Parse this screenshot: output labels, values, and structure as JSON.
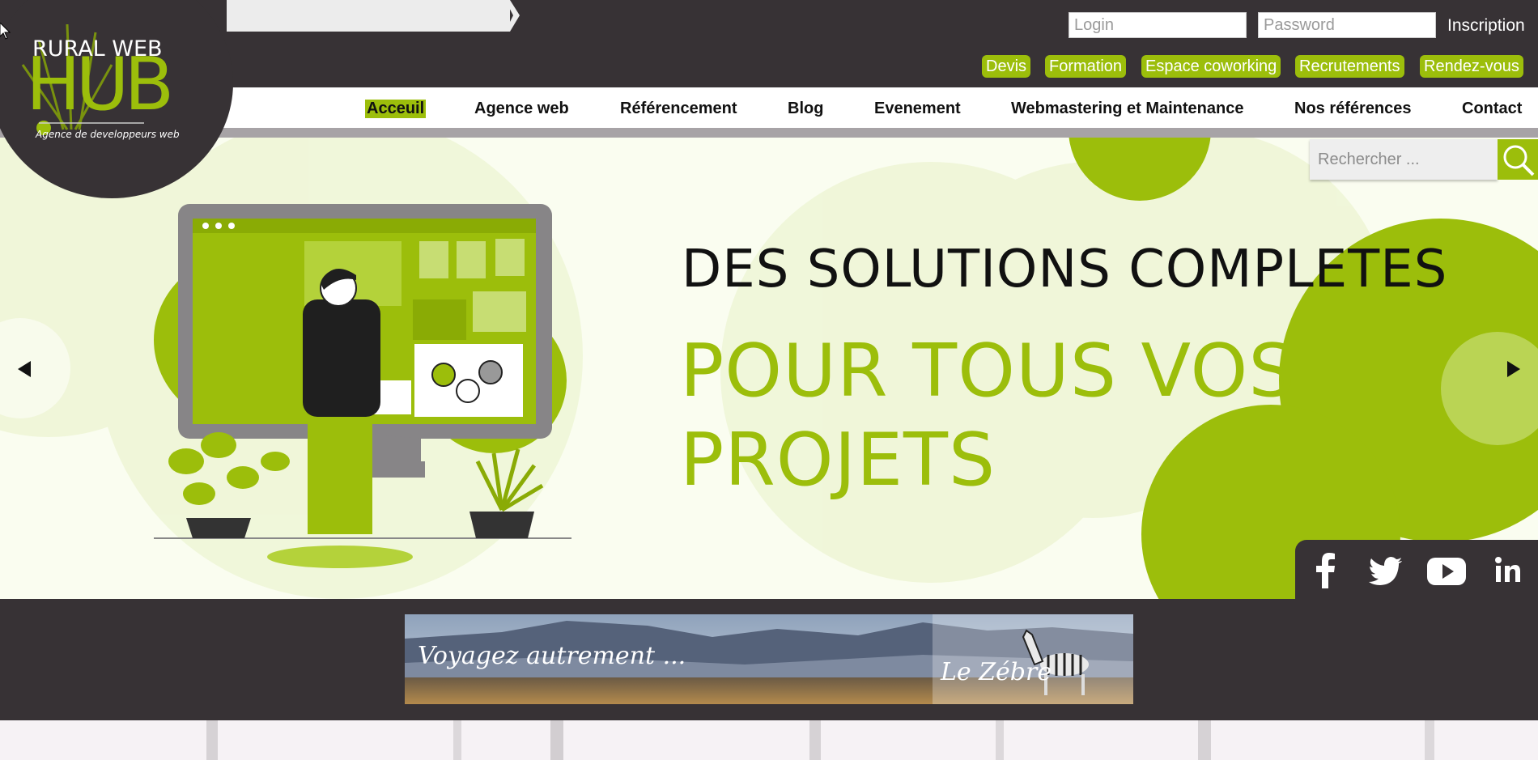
{
  "header": {
    "logo": {
      "line1": "RURAL WEB",
      "line2": "HUB",
      "tagline": "Agence de developpeurs web"
    },
    "login_placeholder": "Login",
    "password_placeholder": "Password",
    "inscription": "Inscription",
    "quick_links": [
      "Devis",
      "Formation",
      "Espace coworking",
      "Recrutements",
      "Rendez-vous"
    ]
  },
  "nav": {
    "items": [
      "Acceuil",
      "Agence web",
      "Référencement",
      "Blog",
      "Evenement",
      "Webmastering et Maintenance",
      "Nos références",
      "Contact"
    ],
    "active_index": 0
  },
  "search": {
    "placeholder": "Rechercher ..."
  },
  "hero": {
    "line1": "DES SOLUTIONS COMPLETES",
    "line2": "POUR TOUS VOS PROJETS"
  },
  "social": [
    "facebook-icon",
    "twitter-icon",
    "youtube-icon",
    "linkedin-icon"
  ],
  "banner": {
    "text1": "Voyagez autrement ...",
    "text2": "Le Zébre"
  },
  "colors": {
    "accent": "#9cbe0b",
    "dark": "#373235",
    "nav_line": "#a7a3a6"
  }
}
